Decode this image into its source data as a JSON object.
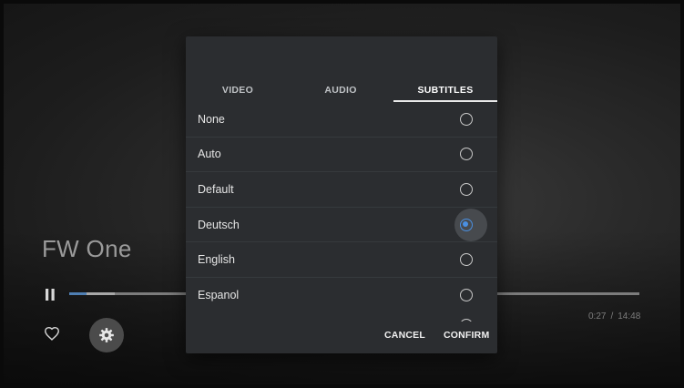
{
  "player": {
    "title": "FW One",
    "current_time": "0:27",
    "time_separator": "/",
    "duration": "14:48",
    "progress_fraction": 0.03,
    "colors": {
      "progress": "#4f7fb3",
      "track": "#7c7c7c"
    },
    "icons": {
      "pause": "pause-icon",
      "favorite": "heart-outline-icon",
      "settings": "gear-icon"
    }
  },
  "dialog": {
    "tabs": [
      {
        "label": "VIDEO",
        "selected": false
      },
      {
        "label": "AUDIO",
        "selected": false
      },
      {
        "label": "SUBTITLES",
        "selected": true
      }
    ],
    "options": [
      {
        "label": "None",
        "selected": false
      },
      {
        "label": "Auto",
        "selected": false
      },
      {
        "label": "Default",
        "selected": false
      },
      {
        "label": "Deutsch",
        "selected": true
      },
      {
        "label": "English",
        "selected": false
      },
      {
        "label": "Espanol",
        "selected": false
      }
    ],
    "cancel_label": "CANCEL",
    "confirm_label": "CONFIRM",
    "accent_color": "#4a90e2"
  }
}
